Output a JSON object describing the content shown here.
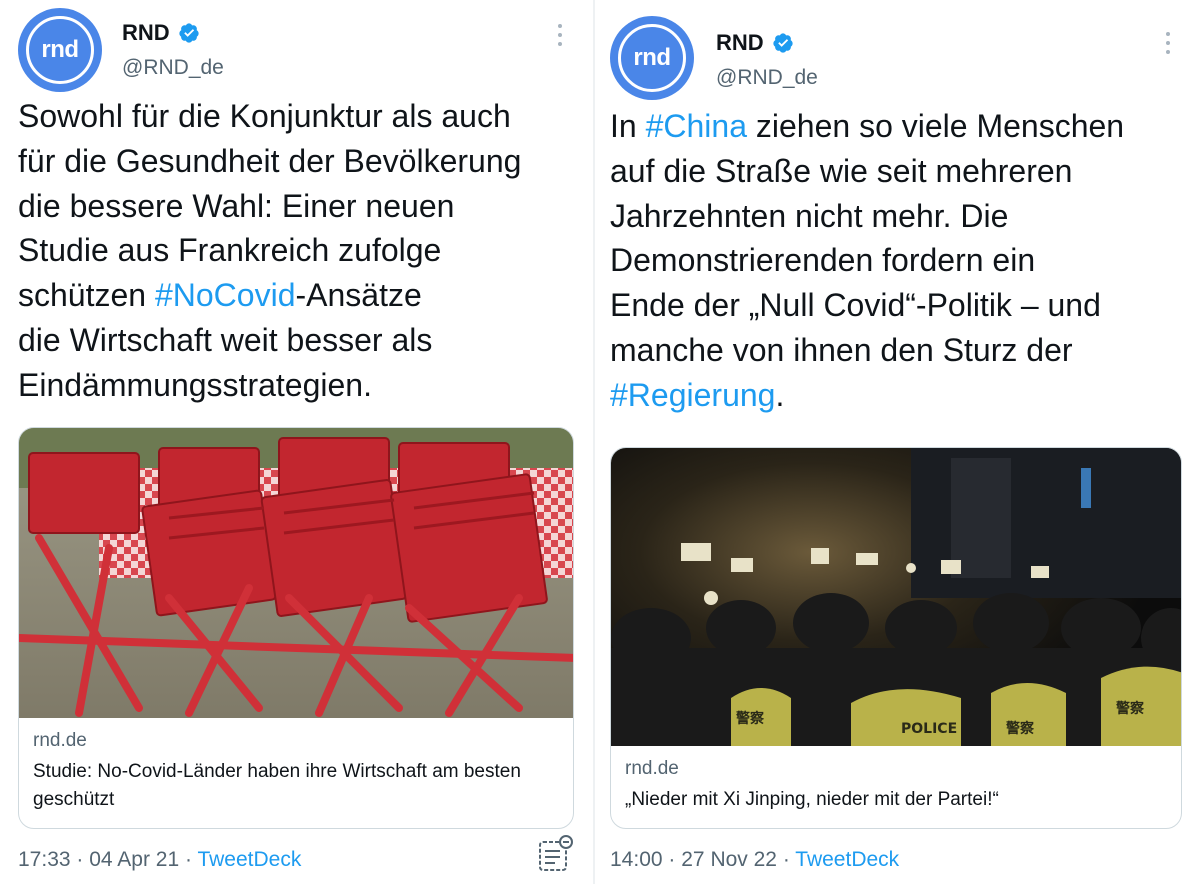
{
  "colors": {
    "brand_blue": "#4a86e8",
    "link_blue": "#1d9bf0",
    "secondary_text": "#536471",
    "border": "#cfd9de"
  },
  "tweets": [
    {
      "avatar_text": "rnd",
      "name": "RND",
      "handle": "@RND_de",
      "text_before": "Sowohl für die Konjunktur als auch\nfür die Gesundheit der Bevölkerung\ndie bessere Wahl: Einer neuen\nStudie aus Frankreich zufolge\nschützen ",
      "hashtag": "#NoCovid",
      "text_after": "-Ansätze\ndie Wirtschaft weit besser als\nEindämmungsstrategien.",
      "card": {
        "image_subject": "red-folding-chairs-photo",
        "domain": "rnd.de",
        "title": "Studie: No-Covid-Länder haben ihre Wirtschaft am besten geschützt"
      },
      "time": "17:33",
      "date": "04 Apr 21",
      "source": "TweetDeck"
    },
    {
      "avatar_text": "rnd",
      "name": "RND",
      "handle": "@RND_de",
      "text_1": "In ",
      "hashtag_1": "#China",
      "text_2": " ziehen so viele Menschen\nauf die Straße wie seit mehreren\nJahrzehnten nicht mehr. Die\nDemonstrierenden fordern ein\nEnde der „Null Covid“-Politik – und\nmanche von ihnen den Sturz der\n",
      "hashtag_2": "#Regierung",
      "text_3": ".",
      "card": {
        "image_subject": "night-protest-crowd-photo",
        "domain": "rnd.de",
        "title": "„Nieder mit Xi Jinping, nieder mit der Partei!“"
      },
      "time": "14:00",
      "date": "27 Nov 22",
      "source": "TweetDeck"
    }
  ],
  "separator": "·"
}
